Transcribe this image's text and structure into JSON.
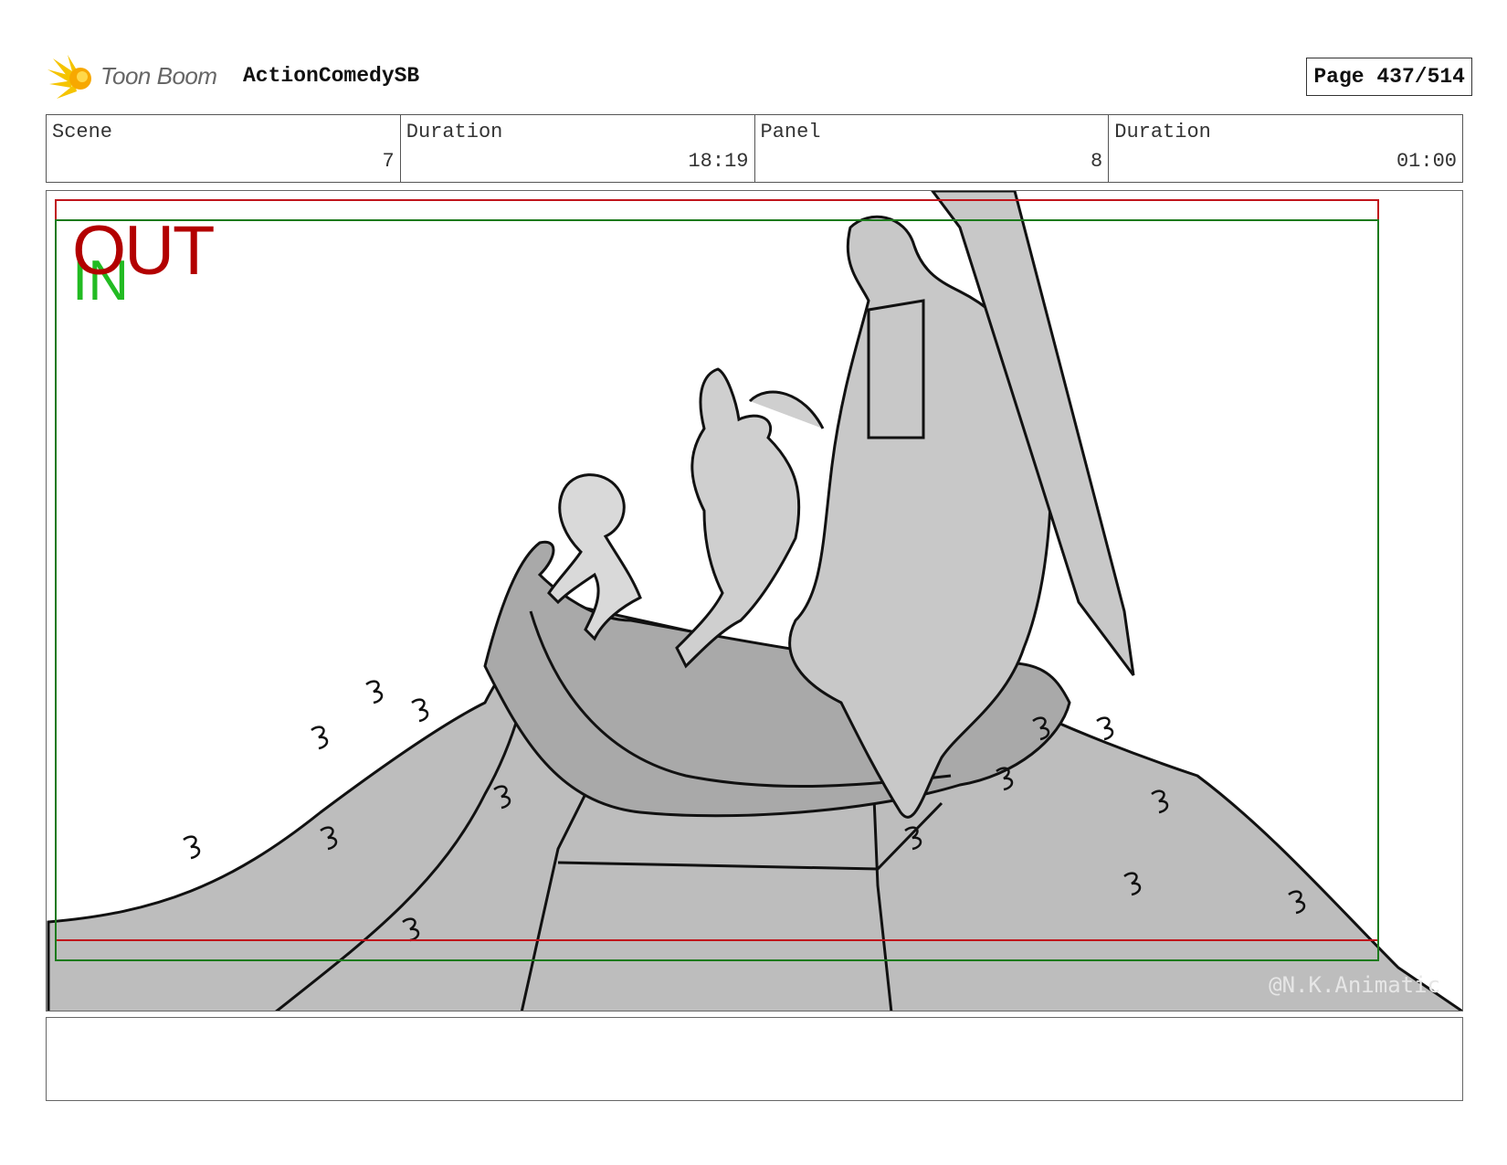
{
  "header": {
    "brand": "Toon Boom",
    "project": "ActionComedySB",
    "page": "Page 437/514"
  },
  "info": {
    "scene_label": "Scene",
    "scene_value": "7",
    "duration_label": "Duration",
    "duration_value": "18:19",
    "panel_label": "Panel",
    "panel_value": "8",
    "panel_duration_label": "Duration",
    "panel_duration_value": "01:00"
  },
  "panel": {
    "out_mark": "OUT",
    "in_mark": "IN",
    "watermark": "@N.K.Animatic",
    "frame_colors": {
      "outer": "#c0141b",
      "inner": "#1c7a1c"
    }
  },
  "notes": {
    "text": ""
  }
}
